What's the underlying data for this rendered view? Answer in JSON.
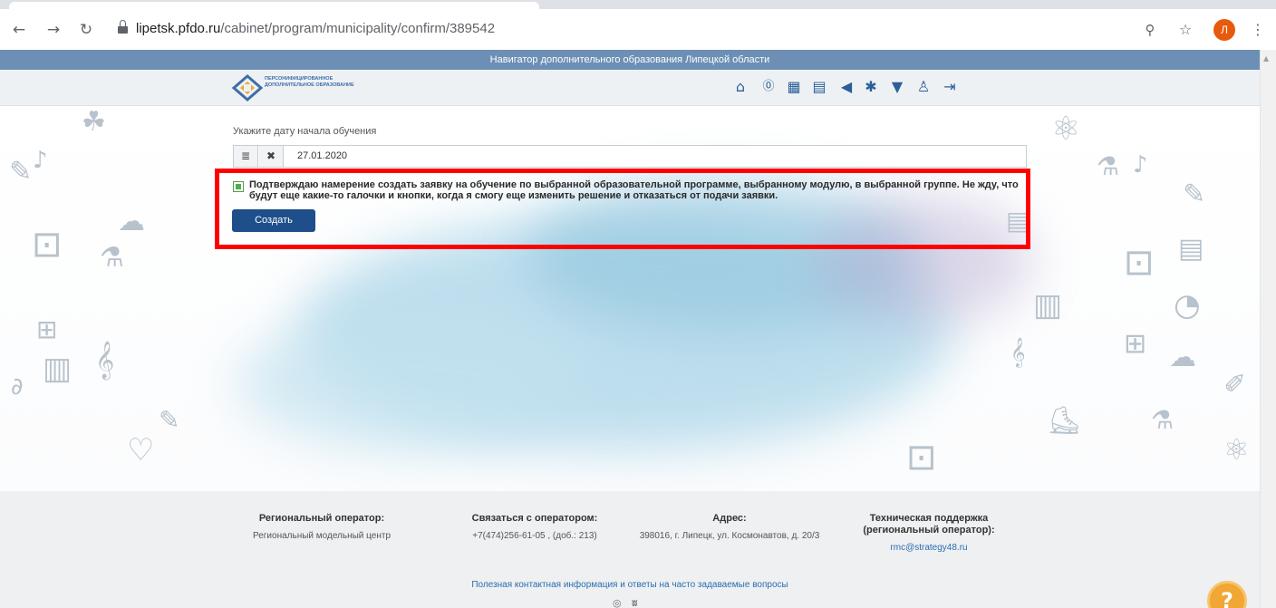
{
  "browser": {
    "url_host": "lipetsk.pfdo.ru",
    "url_path": "/cabinet/program/municipality/confirm/389542",
    "back_icon": "arrow-left-icon",
    "forward_icon": "arrow-right-icon",
    "reload_icon": "reload-icon",
    "zoom_icon": "zoom-icon",
    "star_icon": "star-icon",
    "profile_initial": "Л",
    "menu_icon": "more-vertical-icon"
  },
  "site": {
    "top_banner": "Навигатор дополнительного образования Липецкой области",
    "logo_text": "ПЕРСОНИФИЦИРОВАННОЕ ДОПОЛНИТЕЛЬНОЕ ОБРАЗОВАНИЕ",
    "nav_icons": [
      "home-icon",
      "ruble-icon",
      "calendar-icon",
      "document-icon",
      "megaphone-icon",
      "star-burst-icon",
      "trophy-icon",
      "people-icon",
      "logout-icon"
    ]
  },
  "form": {
    "date_label": "Укажите дату начала обучения",
    "date_value": "27.01.2020",
    "confirm_text": "Подтверждаю намерение создать заявку на обучение по выбранной образовательной программе, выбранному модулю, в выбранной группе. Не жду, что будут еще какие-то галочки и кнопки, когда я смогу еще изменить решение и отказаться от подачи заявки.",
    "confirm_checked": true,
    "create_label": "Создать"
  },
  "footer": {
    "col1_title": "Региональный оператор:",
    "col1_text": "Региональный модельный центр",
    "col2_title": "Связаться с оператором:",
    "col2_text": "+7(474)256-61-05 , (доб.: 213)",
    "col3_title": "Адрес:",
    "col3_text": "398016, г. Липецк, ул. Космонавтов, д. 20/3",
    "col4_title": "Техническая поддержка (региональный оператор):",
    "col4_link": "rmc@strategy48.ru",
    "bottom_link": "Полезная контактная информация и ответы на часто задаваемые вопросы",
    "help_label": "?"
  },
  "colors": {
    "topbar": "#6d8fb5",
    "button": "#1e4f8a",
    "highlight": "#ff0000",
    "help": "#f0a733"
  }
}
